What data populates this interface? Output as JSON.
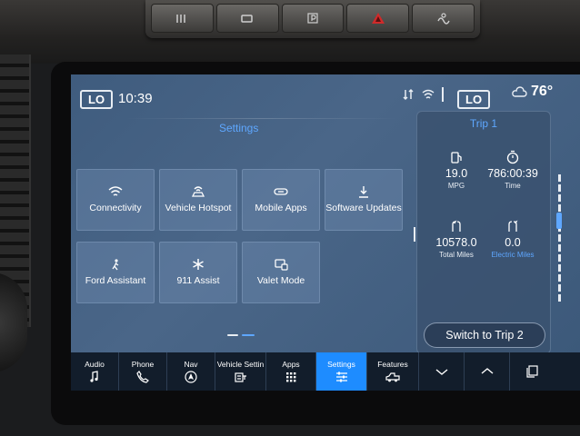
{
  "status": {
    "lo_left": "LO",
    "clock": "10:39",
    "lo_right": "LO",
    "temperature": "76°"
  },
  "settings": {
    "title": "Settings",
    "tiles": [
      {
        "label": "Connectivity",
        "icon": "wifi-icon"
      },
      {
        "label": "Vehicle Hotspot",
        "icon": "hotspot-icon"
      },
      {
        "label": "Mobile Apps",
        "icon": "link-icon"
      },
      {
        "label": "Software Updates",
        "icon": "download-icon"
      },
      {
        "label": "Ford Assistant",
        "icon": "assistant-icon"
      },
      {
        "label": "911 Assist",
        "icon": "emergency-icon"
      },
      {
        "label": "Valet Mode",
        "icon": "valet-lock-icon"
      }
    ],
    "active_page": 2,
    "page_count": 2
  },
  "trip": {
    "title": "Trip 1",
    "mpg_value": "19.0",
    "mpg_label": "MPG",
    "time_value": "786:00:39",
    "time_label": "Time",
    "total_miles_value": "10578.0",
    "total_miles_label": "Total Miles",
    "electric_miles_value": "0.0",
    "electric_miles_label": "Electric Miles",
    "switch_label": "Switch to Trip 2"
  },
  "dock": {
    "audio": "Audio",
    "phone": "Phone",
    "nav": "Nav",
    "vehicle": "Vehicle Settin",
    "apps": "Apps",
    "settings": "Settings",
    "features": "Features",
    "active": "Settings"
  },
  "colors": {
    "accent": "#1e8cff",
    "accent_text": "#5ea7ff",
    "screen_bg": "#4a6688",
    "dock_bg": "#121d2b"
  }
}
